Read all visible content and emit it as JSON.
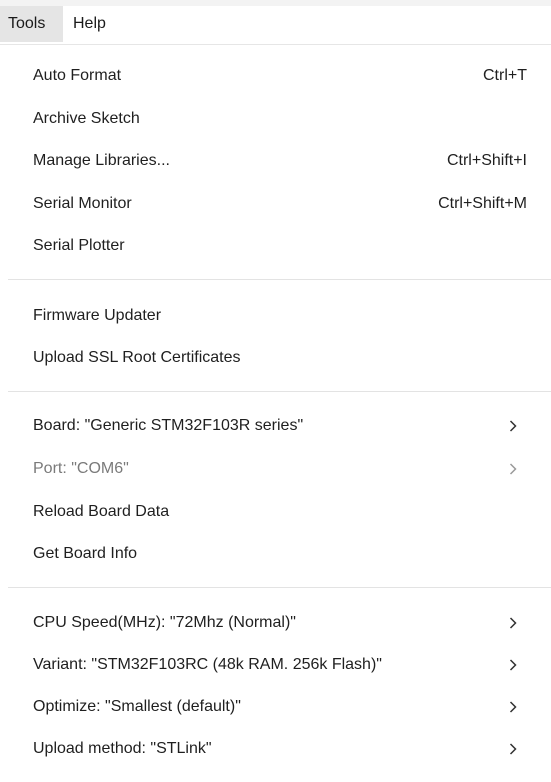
{
  "menubar": {
    "tools_label": "Tools",
    "help_label": "Help"
  },
  "menu": {
    "auto_format": {
      "label": "Auto Format",
      "shortcut": "Ctrl+T"
    },
    "archive_sketch": {
      "label": "Archive Sketch"
    },
    "manage_libraries": {
      "label": "Manage Libraries...",
      "shortcut": "Ctrl+Shift+I"
    },
    "serial_monitor": {
      "label": "Serial Monitor",
      "shortcut": "Ctrl+Shift+M"
    },
    "serial_plotter": {
      "label": "Serial Plotter"
    },
    "firmware_updater": {
      "label": "Firmware Updater"
    },
    "upload_ssl": {
      "label": "Upload SSL Root Certificates"
    },
    "board": {
      "label": "Board: \"Generic STM32F103R series\"",
      "submenu": "chevron-right-icon"
    },
    "port": {
      "label": "Port: \"COM6\"",
      "submenu": "chevron-right-icon",
      "enabled": false
    },
    "reload_board_data": {
      "label": "Reload Board Data"
    },
    "get_board_info": {
      "label": "Get Board Info"
    },
    "cpu_speed": {
      "label": "CPU Speed(MHz): \"72Mhz (Normal)\"",
      "submenu": "chevron-right-icon"
    },
    "variant": {
      "label": "Variant: \"STM32F103RC (48k RAM. 256k Flash)\"",
      "submenu": "chevron-right-icon"
    },
    "optimize": {
      "label": "Optimize: \"Smallest (default)\"",
      "submenu": "chevron-right-icon"
    },
    "upload_method": {
      "label": "Upload method: \"STLink\"",
      "submenu": "chevron-right-icon"
    }
  }
}
